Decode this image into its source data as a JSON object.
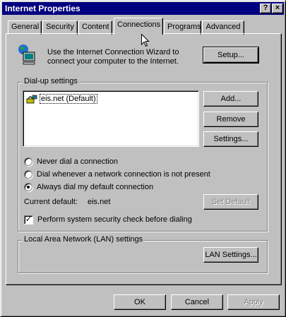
{
  "window": {
    "title": "Internet Properties",
    "help_glyph": "?",
    "close_glyph": "×"
  },
  "tabs": [
    {
      "label": "General"
    },
    {
      "label": "Security"
    },
    {
      "label": "Content"
    },
    {
      "label": "Connections",
      "active": true
    },
    {
      "label": "Programs"
    },
    {
      "label": "Advanced"
    }
  ],
  "wizard": {
    "text_line1": "Use the Internet Connection Wizard to",
    "text_line2": "connect your computer to the Internet.",
    "setup_label": "Setup...",
    "icon": "connection-wizard-icon"
  },
  "dialup": {
    "group_label": "Dial-up settings",
    "connections": [
      {
        "name": "eis.net (Default)",
        "icon": "dialup-connection-icon"
      }
    ],
    "add_label": "Add...",
    "remove_label": "Remove",
    "settings_label": "Settings...",
    "options": [
      {
        "label": "Never dial a connection",
        "checked": false
      },
      {
        "label": "Dial whenever a network connection is not present",
        "checked": false
      },
      {
        "label": "Always dial my default connection",
        "checked": true
      }
    ],
    "current_default_label": "Current default:",
    "current_default_value": "eis.net",
    "set_default_label": "Set Default",
    "security_check_label": "Perform system security check before dialing",
    "security_check_checked": true,
    "check_mark": "✓"
  },
  "lan": {
    "group_label": "Local Area Network (LAN) settings",
    "lan_settings_label": "LAN Settings..."
  },
  "footer": {
    "ok_label": "OK",
    "cancel_label": "Cancel",
    "apply_label": "Apply"
  },
  "colors": {
    "titlebar": "#000080",
    "face": "#c0c0c0",
    "shadow": "#808080",
    "highlight": "#ffffff"
  }
}
